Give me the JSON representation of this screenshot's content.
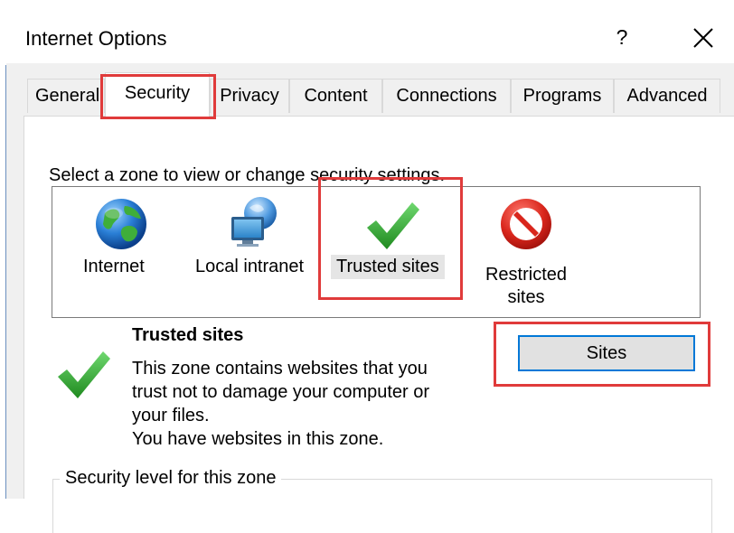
{
  "window": {
    "title": "Internet Options",
    "help_label": "?"
  },
  "tabs": [
    {
      "label": "General"
    },
    {
      "label": "Security"
    },
    {
      "label": "Privacy"
    },
    {
      "label": "Content"
    },
    {
      "label": "Connections"
    },
    {
      "label": "Programs"
    },
    {
      "label": "Advanced"
    }
  ],
  "active_tab": "Security",
  "zones": {
    "intro": "Select a zone to view or change security settings.",
    "items": [
      {
        "label": "Internet",
        "icon": "globe-icon"
      },
      {
        "label": "Local intranet",
        "icon": "intranet-icon"
      },
      {
        "label": "Trusted sites",
        "icon": "checkmark-icon"
      },
      {
        "label_line1": "Restricted",
        "label_line2": "sites",
        "icon": "prohibited-icon"
      }
    ],
    "selected": "Trusted sites"
  },
  "details": {
    "title": "Trusted sites",
    "lines": [
      "This zone contains websites that you",
      "trust not to damage your computer or",
      "your files.",
      "You have websites in this zone."
    ],
    "sites_button": "Sites"
  },
  "security_level": {
    "label": "Security level for this zone"
  },
  "colors": {
    "highlight_box": "#e03b3b",
    "focus_blue": "#0078d7",
    "check_green": "#3aa83a",
    "prohibit_red": "#d9261c"
  }
}
